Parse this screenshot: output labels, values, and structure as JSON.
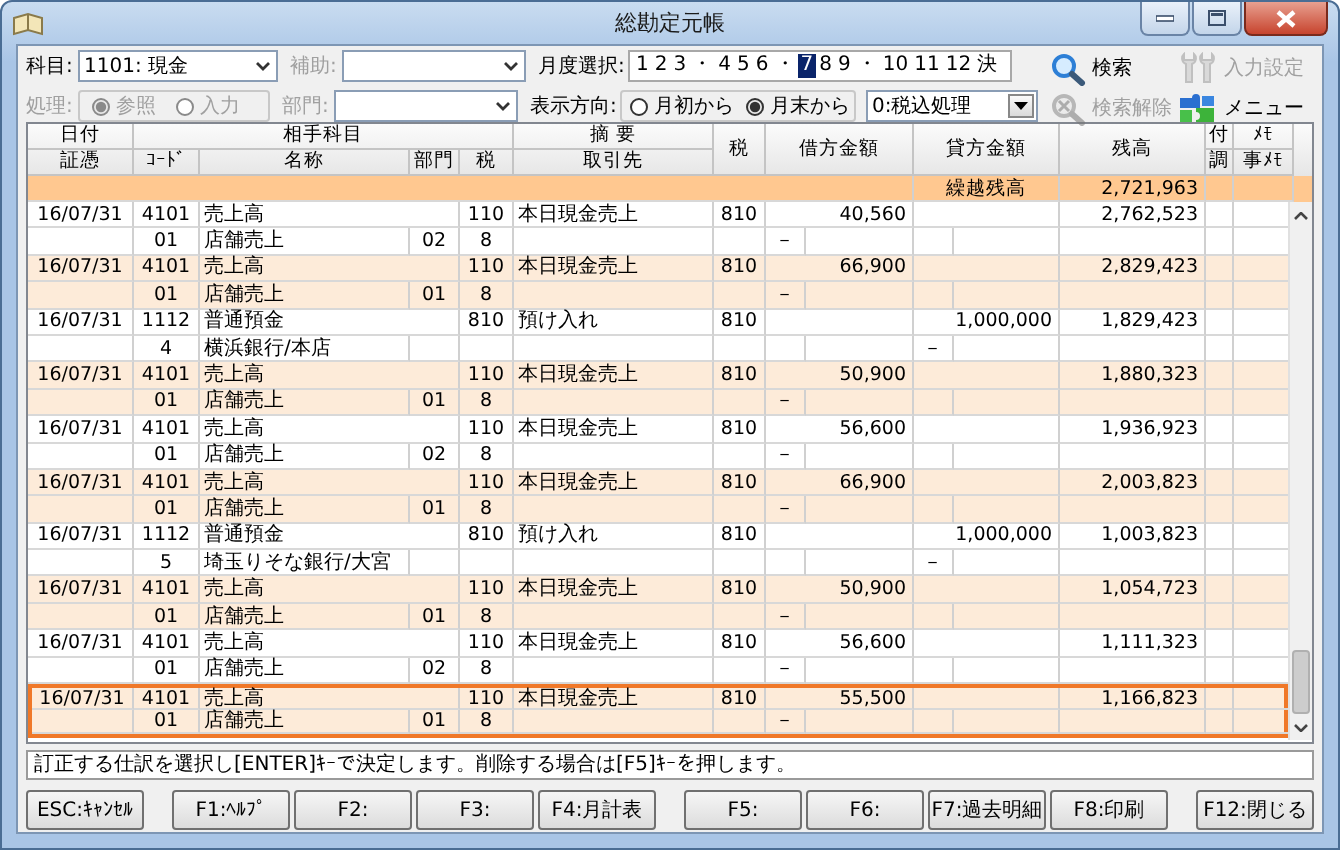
{
  "window": {
    "title": "総勘定元帳"
  },
  "account": {
    "label": "科目:",
    "value": "1101: 現金"
  },
  "sub_account": {
    "label": "補助:",
    "disabled": true
  },
  "month_select": {
    "label": "月度選択:",
    "months": [
      {
        "label": "1",
        "kind": "month",
        "selected": false
      },
      {
        "label": "2",
        "kind": "month",
        "selected": false
      },
      {
        "label": "3",
        "kind": "month",
        "selected": false
      },
      {
        "label": "・",
        "kind": "separator"
      },
      {
        "label": "4",
        "kind": "month",
        "selected": false
      },
      {
        "label": "5",
        "kind": "month",
        "selected": false
      },
      {
        "label": "6",
        "kind": "month",
        "selected": false
      },
      {
        "label": "・",
        "kind": "separator"
      },
      {
        "label": "7",
        "kind": "month",
        "selected": true
      },
      {
        "label": "8",
        "kind": "month",
        "selected": false
      },
      {
        "label": "9",
        "kind": "month",
        "selected": false
      },
      {
        "label": "・",
        "kind": "separator"
      },
      {
        "label": "10",
        "kind": "month",
        "selected": false
      },
      {
        "label": "11",
        "kind": "month",
        "selected": false
      },
      {
        "label": "12",
        "kind": "month",
        "selected": false
      },
      {
        "label": "決",
        "kind": "month",
        "selected": false
      }
    ]
  },
  "process": {
    "label": "処理:",
    "disabled": true,
    "options": [
      {
        "label": "参照",
        "selected": true
      },
      {
        "label": "入力",
        "selected": false
      }
    ]
  },
  "department": {
    "label": "部門:",
    "disabled": true
  },
  "direction": {
    "label": "表示方向:",
    "options": [
      {
        "label": "月初から",
        "selected": false
      },
      {
        "label": "月末から",
        "selected": true
      }
    ]
  },
  "tax_mode": {
    "value": "0:税込処理"
  },
  "tools": [
    {
      "label": "検索",
      "kind": "search",
      "disabled": false
    },
    {
      "label": "入力設定",
      "kind": "settings",
      "disabled": true
    },
    {
      "label": "検索解除",
      "kind": "clear_search",
      "disabled": true
    },
    {
      "label": "メニュー",
      "kind": "menu",
      "disabled": false
    }
  ],
  "table": {
    "header": {
      "date": "日付",
      "voucher": "証憑",
      "counterpart": "相手科目",
      "code": "ｺｰﾄﾞ",
      "name": "名称",
      "dept": "部門",
      "tax": "税",
      "summary": "摘 要",
      "client": "取引先",
      "tax_code": "税",
      "debit": "借方金額",
      "credit": "貸方金額",
      "balance": "残高",
      "attach": "付",
      "adjust": "調",
      "memo": "ﾒﾓ",
      "memo2": "事ﾒﾓ"
    },
    "carryover": {
      "label": "繰越残高",
      "balance": "2,721,963"
    },
    "entries": [
      {
        "date": "16/07/31",
        "code": "4101",
        "name": "売上高",
        "tax": "110",
        "summary": "本日現金売上",
        "tax_code": "810",
        "debit": "40,560",
        "balance": "2,762,523",
        "selected": false,
        "sub": {
          "code": "01",
          "name": "店舗売上",
          "dept": "02",
          "tax": "8",
          "debit_mark": "－"
        }
      },
      {
        "date": "16/07/31",
        "code": "4101",
        "name": "売上高",
        "tax": "110",
        "summary": "本日現金売上",
        "tax_code": "810",
        "debit": "66,900",
        "balance": "2,829,423",
        "selected": false,
        "sub": {
          "code": "01",
          "name": "店舗売上",
          "dept": "01",
          "tax": "8",
          "debit_mark": "－"
        }
      },
      {
        "date": "16/07/31",
        "code": "1112",
        "name": "普通預金",
        "tax": "810",
        "summary": "預け入れ",
        "tax_code": "810",
        "credit": "1,000,000",
        "balance": "1,829,423",
        "selected": false,
        "sub": {
          "code": "4",
          "name": "横浜銀行/本店",
          "credit_mark": "－"
        }
      },
      {
        "date": "16/07/31",
        "code": "4101",
        "name": "売上高",
        "tax": "110",
        "summary": "本日現金売上",
        "tax_code": "810",
        "debit": "50,900",
        "balance": "1,880,323",
        "selected": false,
        "sub": {
          "code": "01",
          "name": "店舗売上",
          "dept": "01",
          "tax": "8",
          "debit_mark": "－"
        }
      },
      {
        "date": "16/07/31",
        "code": "4101",
        "name": "売上高",
        "tax": "110",
        "summary": "本日現金売上",
        "tax_code": "810",
        "debit": "56,600",
        "balance": "1,936,923",
        "selected": false,
        "sub": {
          "code": "01",
          "name": "店舗売上",
          "dept": "02",
          "tax": "8",
          "debit_mark": "－"
        }
      },
      {
        "date": "16/07/31",
        "code": "4101",
        "name": "売上高",
        "tax": "110",
        "summary": "本日現金売上",
        "tax_code": "810",
        "debit": "66,900",
        "balance": "2,003,823",
        "selected": false,
        "sub": {
          "code": "01",
          "name": "店舗売上",
          "dept": "01",
          "tax": "8",
          "debit_mark": "－"
        }
      },
      {
        "date": "16/07/31",
        "code": "1112",
        "name": "普通預金",
        "tax": "810",
        "summary": "預け入れ",
        "tax_code": "810",
        "credit": "1,000,000",
        "balance": "1,003,823",
        "selected": false,
        "sub": {
          "code": "5",
          "name": "埼玉りそな銀行/大宮",
          "credit_mark": "－"
        }
      },
      {
        "date": "16/07/31",
        "code": "4101",
        "name": "売上高",
        "tax": "110",
        "summary": "本日現金売上",
        "tax_code": "810",
        "debit": "50,900",
        "balance": "1,054,723",
        "selected": false,
        "sub": {
          "code": "01",
          "name": "店舗売上",
          "dept": "01",
          "tax": "8",
          "debit_mark": "－"
        }
      },
      {
        "date": "16/07/31",
        "code": "4101",
        "name": "売上高",
        "tax": "110",
        "summary": "本日現金売上",
        "tax_code": "810",
        "debit": "56,600",
        "balance": "1,111,323",
        "selected": false,
        "sub": {
          "code": "01",
          "name": "店舗売上",
          "dept": "02",
          "tax": "8",
          "debit_mark": "－"
        }
      },
      {
        "date": "16/07/31",
        "code": "4101",
        "name": "売上高",
        "tax": "110",
        "summary": "本日現金売上",
        "tax_code": "810",
        "debit": "55,500",
        "balance": "1,166,823",
        "selected": true,
        "sub": {
          "code": "01",
          "name": "店舗売上",
          "dept": "01",
          "tax": "8",
          "debit_mark": "－"
        }
      }
    ]
  },
  "status_message": "訂正する仕訳を選択し[ENTER]ｷｰで決定します。削除する場合は[F5]ｷｰを押します。",
  "function_key_groups": [
    {
      "keys": [
        "ESC:ｷｬﾝｾﾙ"
      ]
    },
    {
      "keys": [
        "F1:ﾍﾙﾌﾟ",
        "F2:",
        "F3:",
        "F4:月計表"
      ]
    },
    {
      "keys": [
        "F5:",
        "F6:",
        "F7:過去明細",
        "F8:印刷"
      ]
    },
    {
      "keys": [
        "F12:閉じる"
      ]
    }
  ]
}
